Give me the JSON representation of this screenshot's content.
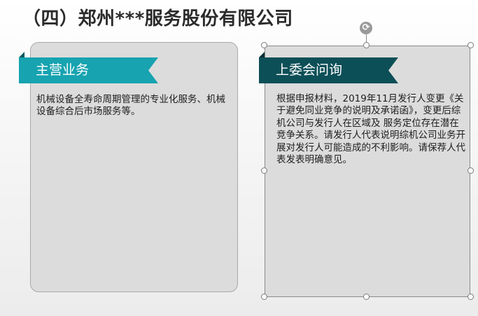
{
  "slide": {
    "title": "（四）郑州***服务股份有限公司"
  },
  "left_card": {
    "ribbon_label": "主营业务",
    "body": "机械设备全寿命周期管理的专业化服务、机械设备综合后市场服务等。"
  },
  "right_card": {
    "ribbon_label": "上委会问询",
    "body": "根据申报材料，2019年11月发行人变更《关于避免同业竞争的说明及承诺函》，变更后综机公司与发行人在区域及  服务定位存在潜在竞争关系。请发行人代表说明综机公司业务开展对发行人可能造成的不利影响。请保荐人代表发表明确意见。"
  },
  "colors": {
    "ribbon_left": "#17a3b0",
    "ribbon_right": "#0d4f57",
    "card_fill": "#dcdcdc"
  },
  "icons": {
    "rotate_handle": "rotate-icon"
  }
}
